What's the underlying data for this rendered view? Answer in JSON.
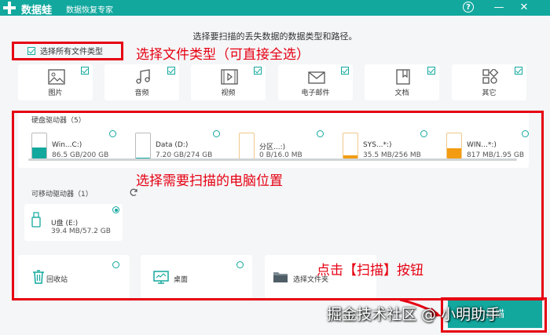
{
  "app": {
    "name": "数据蛙",
    "subtitle": "数据恢复专家",
    "help_symbol": "?",
    "minimize_symbol": "—",
    "close_symbol": "✕",
    "accent_color": "#13a89e"
  },
  "main": {
    "title": "选择要扫描的丢失数据的数据类型和路径。",
    "select_all_label": "选择所有文件类型"
  },
  "file_types": [
    {
      "label": "图片",
      "icon": "image-icon",
      "checked": true
    },
    {
      "label": "音频",
      "icon": "music-icon",
      "checked": true
    },
    {
      "label": "视频",
      "icon": "video-icon",
      "checked": true
    },
    {
      "label": "电子邮件",
      "icon": "mail-icon",
      "checked": true
    },
    {
      "label": "文档",
      "icon": "document-icon",
      "checked": true
    },
    {
      "label": "其它",
      "icon": "other-icon",
      "checked": true
    }
  ],
  "hard_drives": {
    "label": "硬盘驱动器（5）",
    "items": [
      {
        "name": "Win...C:)",
        "size": "86.5 GB/200 GB",
        "fill_color": "#13a89e",
        "used_fraction": 0.43
      },
      {
        "name": "Data (D:)",
        "size": "7.20 GB/274 GB",
        "fill_color": "#13a89e",
        "used_fraction": 0.03
      },
      {
        "name": "分区...:)",
        "size": "0 B/16.0 MB",
        "fill_color": "#f39c12",
        "used_fraction": 0.0
      },
      {
        "name": "SYS...*:)",
        "size": "35.5 MB/256 MB",
        "fill_color": "#f39c12",
        "used_fraction": 0.14
      },
      {
        "name": "WIN...*:)",
        "size": "817 MB/1.95 GB",
        "fill_color": "#f39c12",
        "used_fraction": 0.42
      }
    ]
  },
  "removable": {
    "label": "可移动驱动器（1）",
    "refresh_icon": "refresh-icon",
    "items": [
      {
        "name": "U盘 (E:)",
        "size": "39.4 MB/57.2 GB",
        "selected": true
      }
    ]
  },
  "locations": [
    {
      "label": "回收站",
      "icon": "trash-icon"
    },
    {
      "label": "桌面",
      "icon": "desktop-icon"
    },
    {
      "label": "选择文件夹",
      "icon": "folder-icon"
    }
  ],
  "annotations": {
    "file_types": "选择文件类型（可直接全选）",
    "location": "选择需要扫描的电脑位置",
    "scan": "点击【扫描】按钮"
  },
  "scan_button": {
    "label": "扫描"
  },
  "watermark": "掘金技术社区 @ 小明助手"
}
